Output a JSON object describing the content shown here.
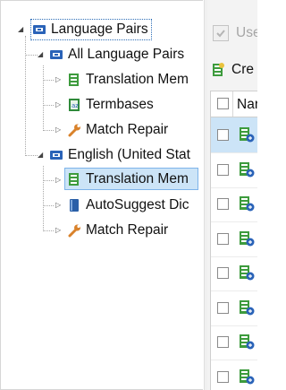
{
  "tree": {
    "root": {
      "label": "Language Pairs",
      "icon": "language-pair-icon"
    },
    "all_pairs": {
      "label": "All Language Pairs",
      "icon": "language-pair-icon"
    },
    "all_children": [
      {
        "label": "Translation Mem",
        "icon": "translation-memory-icon"
      },
      {
        "label": "Termbases",
        "icon": "termbase-icon"
      },
      {
        "label": "Match Repair",
        "icon": "wrench-icon"
      }
    ],
    "english": {
      "label": "English (United Stat",
      "icon": "language-pair-icon"
    },
    "english_children": [
      {
        "label": "Translation Mem",
        "icon": "translation-memory-icon",
        "selected": true
      },
      {
        "label": "AutoSuggest Dic",
        "icon": "autosuggest-dictionary-icon"
      },
      {
        "label": "Match Repair",
        "icon": "wrench-icon"
      }
    ]
  },
  "right_panel": {
    "use_label": "Use",
    "create_label": "Cre",
    "name_header": "Nar",
    "row_count": 8
  },
  "colors": {
    "selection_bg": "#cce4f7",
    "selection_border": "#7eb4ea",
    "tm_icon_green": "#3d9b3d",
    "lp_icon_blue": "#2a63b8",
    "wrench_orange": "#d9822b"
  }
}
